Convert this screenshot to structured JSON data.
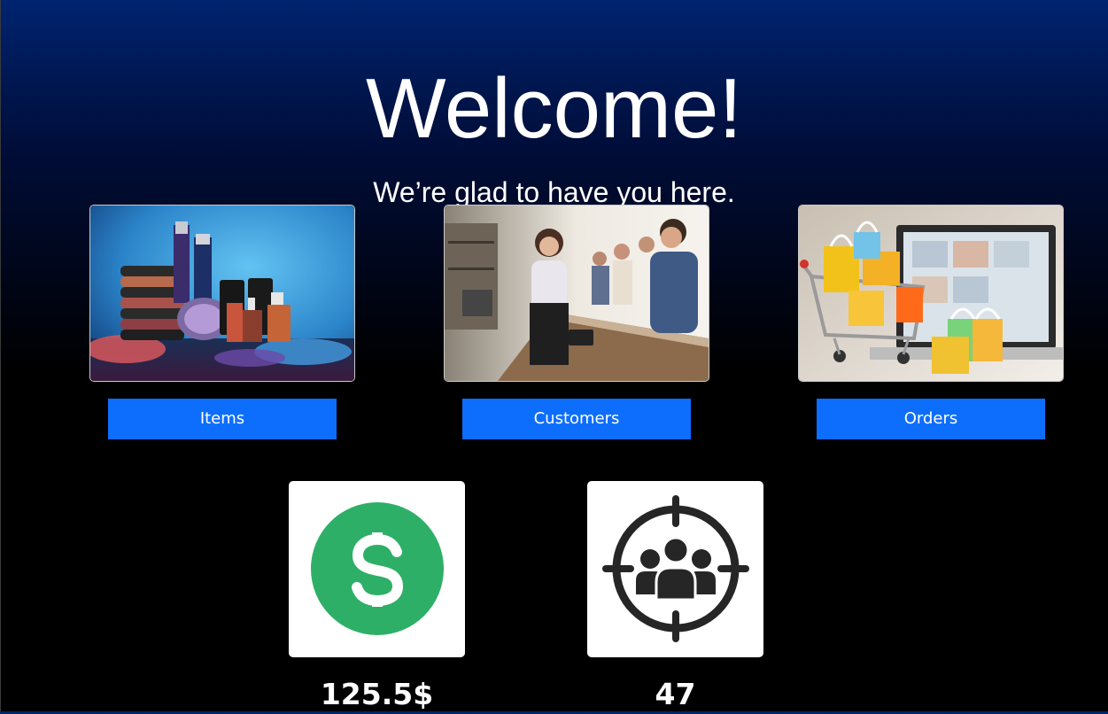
{
  "header": {
    "title": "Welcome!",
    "subtitle": "We’re glad to have you here."
  },
  "nav": [
    {
      "label": "Items",
      "image": "cosmetics-products-photo"
    },
    {
      "label": "Customers",
      "image": "customers-at-counter-photo"
    },
    {
      "label": "Orders",
      "image": "shopping-cart-laptop-photo"
    }
  ],
  "stats": [
    {
      "value": "125.5$",
      "icon": "dollar-icon",
      "icon_color": "#2eaf67"
    },
    {
      "value": "47",
      "icon": "target-audience-icon",
      "icon_color": "#262626"
    }
  ],
  "colors": {
    "accent": "#0d6efd",
    "background_top": "#00236f",
    "background_bottom": "#000000"
  }
}
